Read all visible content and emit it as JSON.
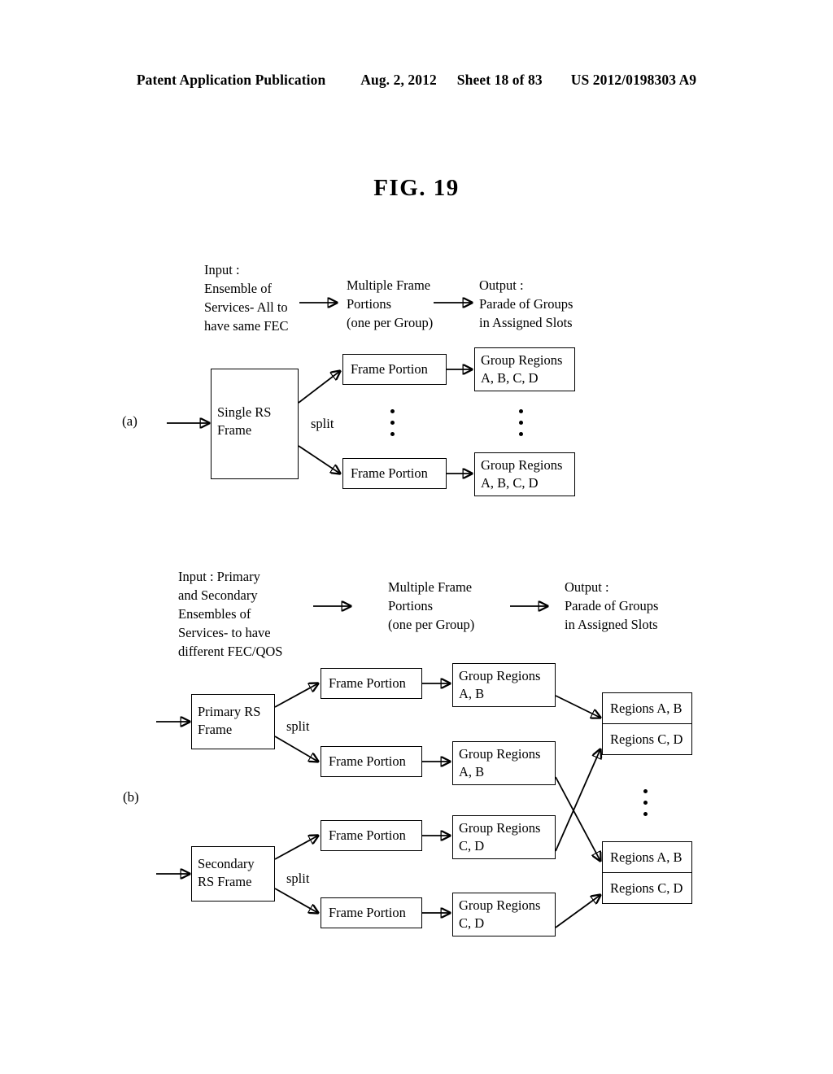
{
  "header": {
    "publication": "Patent Application Publication",
    "date": "Aug. 2, 2012",
    "sheet": "Sheet 18 of 83",
    "patent_number": "US 2012/0198303 A9"
  },
  "figure": {
    "title": "FIG. 19"
  },
  "part_a": {
    "label": "(a)",
    "column_headers": {
      "input": "Input :\nEnsemble of\nServices- All to\nhave same FEC",
      "middle": "Multiple Frame\nPortions\n(one per Group)",
      "output": "Output :\nParade of Groups\nin Assigned Slots"
    },
    "split_label": "split",
    "source_box": "Single RS\nFrame",
    "frame_portion_top": "Frame Portion",
    "frame_portion_bottom": "Frame Portion",
    "group_regions_top": "Group Regions\nA, B, C, D",
    "group_regions_bottom": "Group Regions\nA, B, C, D",
    "ellipsis_middle": "vertical-ellipsis",
    "ellipsis_right": "vertical-ellipsis"
  },
  "part_b": {
    "label": "(b)",
    "column_headers": {
      "input": "Input : Primary\nand Secondary\nEnsembles of\nServices- to have\ndifferent FEC/QOS",
      "middle": "Multiple Frame\nPortions\n(one per Group)",
      "output": "Output :\nParade of Groups\nin Assigned Slots"
    },
    "primary": {
      "source_box": "Primary RS\nFrame",
      "split_label": "split",
      "frame_portion_top": "Frame Portion",
      "frame_portion_bottom": "Frame Portion",
      "group_regions_top": "Group Regions\nA, B",
      "group_regions_bottom": "Group Regions\nA, B"
    },
    "secondary": {
      "source_box": "Secondary\nRS Frame",
      "split_label": "split",
      "frame_portion_top": "Frame Portion",
      "frame_portion_bottom": "Frame Portion",
      "group_regions_top": "Group Regions\nC, D",
      "group_regions_bottom": "Group Regions\nC, D"
    },
    "output_slots": [
      {
        "row_top": "Regions A, B",
        "row_bottom": "Regions C, D"
      },
      {
        "row_top": "Regions A, B",
        "row_bottom": "Regions C, D"
      }
    ],
    "ellipsis_right": "vertical-ellipsis"
  },
  "colors": {
    "ink": "#000000",
    "paper": "#ffffff"
  }
}
